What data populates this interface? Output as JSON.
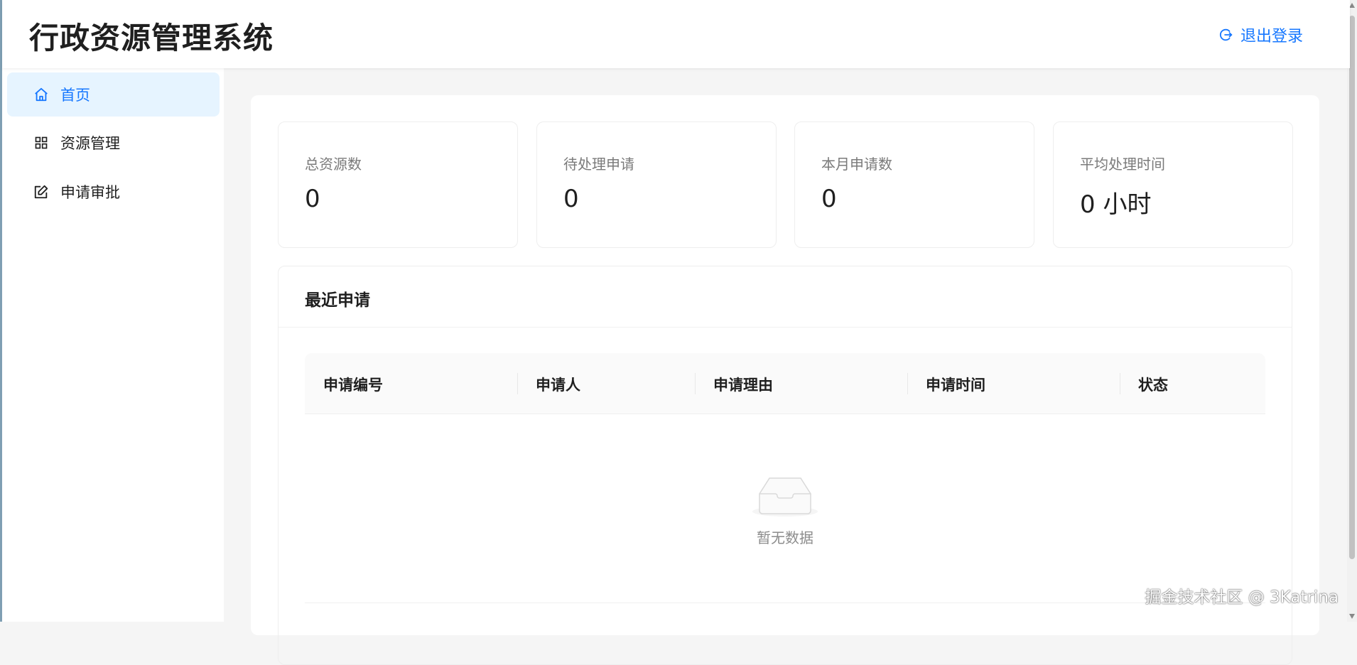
{
  "header": {
    "title": "行政资源管理系统",
    "logout_label": "退出登录",
    "logout_icon": "logout-icon"
  },
  "sidebar": {
    "items": [
      {
        "label": "首页",
        "icon": "home-icon",
        "active": true
      },
      {
        "label": "资源管理",
        "icon": "grid-icon",
        "active": false
      },
      {
        "label": "申请审批",
        "icon": "edit-icon",
        "active": false
      }
    ]
  },
  "stats": [
    {
      "label": "总资源数",
      "value": "0"
    },
    {
      "label": "待处理申请",
      "value": "0"
    },
    {
      "label": "本月申请数",
      "value": "0"
    },
    {
      "label": "平均处理时间",
      "value": "0 小时"
    }
  ],
  "recent": {
    "title": "最近申请",
    "columns": [
      "申请编号",
      "申请人",
      "申请理由",
      "申请时间",
      "状态"
    ],
    "rows": [],
    "empty_text": "暂无数据"
  },
  "watermark": "掘金技术社区 @ 3Katrina",
  "colors": {
    "accent": "#1677ff",
    "active_bg": "#e6f4ff",
    "page_bg": "#f5f5f5"
  }
}
